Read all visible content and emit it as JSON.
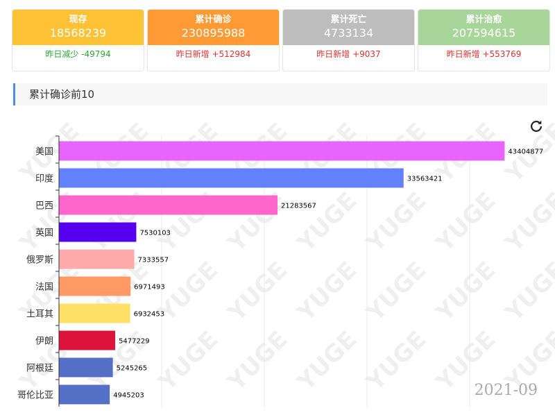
{
  "cards": [
    {
      "title": "现存",
      "value": "18568239",
      "delta": "昨日减少 -49794",
      "head_color": "#ffc235",
      "delta_color": "#2aa730"
    },
    {
      "title": "累计确诊",
      "value": "230895988",
      "delta": "昨日新增 +512984",
      "head_color": "#ff9a35",
      "delta_color": "#e03030"
    },
    {
      "title": "累计死亡",
      "value": "4733134",
      "delta": "昨日新增 +9037",
      "head_color": "#bdbdbd",
      "delta_color": "#e03030"
    },
    {
      "title": "累计治愈",
      "value": "207594615",
      "delta": "昨日新增 +553769",
      "head_color": "#a8d69a",
      "delta_color": "#e03030"
    }
  ],
  "section": {
    "title": "累计确诊前10"
  },
  "toolbar": {
    "refresh_icon": "refresh-icon"
  },
  "watermark": "YUGE",
  "chart_data": {
    "type": "bar",
    "orientation": "horizontal",
    "categories": [
      "美国",
      "印度",
      "巴西",
      "英国",
      "俄罗斯",
      "法国",
      "土耳其",
      "伊朗",
      "阿根廷",
      "哥伦比亚"
    ],
    "values": [
      43404877,
      33563421,
      21283567,
      7530103,
      7333557,
      6971493,
      6932453,
      5477229,
      5245265,
      4945203
    ],
    "colors": [
      "#e864ff",
      "#6281ff",
      "#ff66cc",
      "#5500ee",
      "#ffaaaa",
      "#ff9966",
      "#ffe066",
      "#dc143c",
      "#5470c6",
      "#5470c6"
    ],
    "xlim": [
      0,
      50000000
    ],
    "grid": true,
    "timeline": "2021-09"
  }
}
